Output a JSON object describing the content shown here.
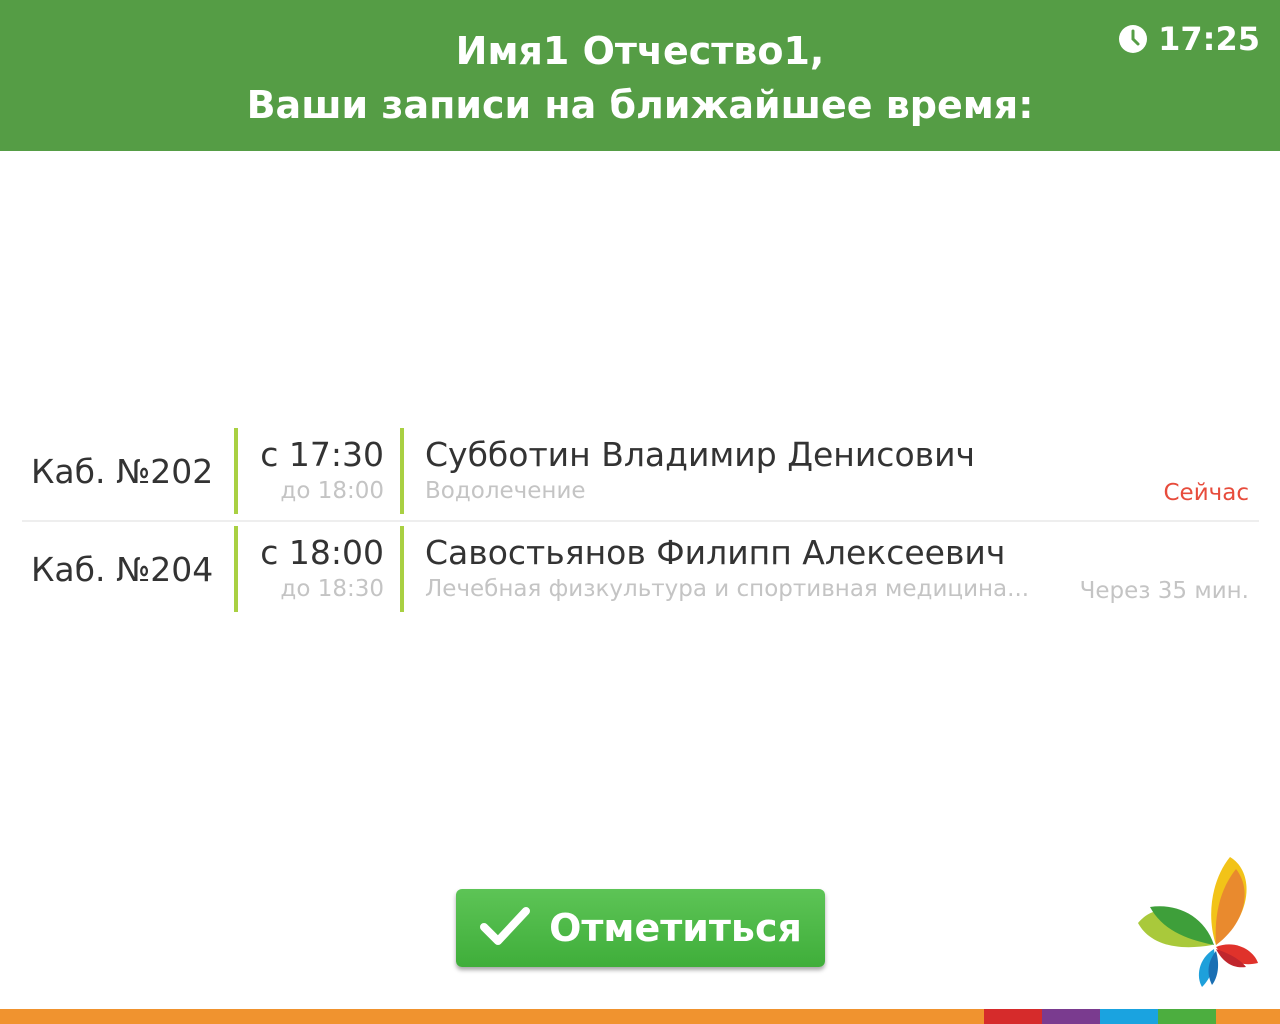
{
  "header": {
    "greeting_line1": "Имя1 Отчество1,",
    "greeting_line2": "Ваши записи на ближайшее время:",
    "clock_icon": "clock-icon",
    "time": "17:25",
    "background_color": "#559d45"
  },
  "appointments": [
    {
      "room": "Каб. №202",
      "time_from": "с 17:30",
      "time_to": "до 18:00",
      "doctor": "Субботин Владимир Денисович",
      "specialty": "Водолечение",
      "status": "Сейчас",
      "status_color": "#e74c3c"
    },
    {
      "room": "Каб. №204",
      "time_from": "с 18:00",
      "time_to": "до 18:30",
      "doctor": "Савостьянов Филипп Алексеевич",
      "specialty": "Лечебная физкультура и спортивная медицина...",
      "status": "Через 35 мин.",
      "status_color": "#c4c4c4"
    }
  ],
  "checkin_button": {
    "label": "Отметиться",
    "icon": "checkmark-icon",
    "color": "#4cb848"
  },
  "logo": {
    "icon": "butterfly-logo-icon"
  },
  "colors": {
    "accent_separator": "#a9d042",
    "footer_orange": "#f0932f",
    "footer_red": "#d62b2b",
    "footer_purple": "#7a3b8f",
    "footer_blue": "#1aa3e0",
    "footer_green": "#4cae3f"
  }
}
